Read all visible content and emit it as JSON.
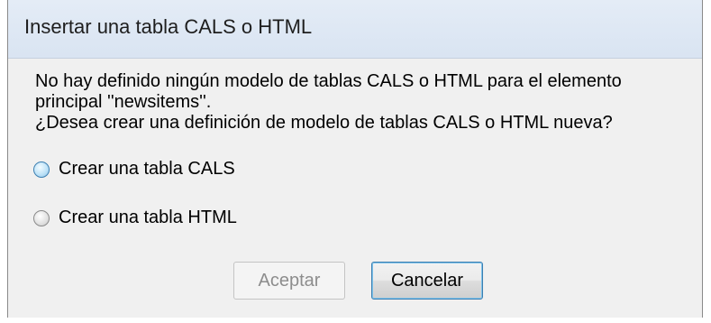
{
  "dialog": {
    "title": "Insertar una tabla CALS o HTML",
    "message_line1": "No hay definido ningún modelo de tablas CALS o HTML para el elemento",
    "message_line2": "principal ''newsitems''.",
    "message_line3": "¿Desea crear una definición de modelo de tablas CALS o HTML nueva?",
    "options": [
      {
        "label": "Crear una tabla CALS",
        "focused": true,
        "selected": false
      },
      {
        "label": "Crear una tabla HTML",
        "focused": false,
        "selected": false
      }
    ],
    "buttons": {
      "ok_label": "Aceptar",
      "ok_enabled": false,
      "cancel_label": "Cancelar"
    }
  },
  "colors": {
    "titlebar": "#dbe6f3",
    "dialog_bg": "#f0f0f0",
    "focus_border": "#3c7fb1",
    "disabled_text": "#8d8d8d"
  }
}
